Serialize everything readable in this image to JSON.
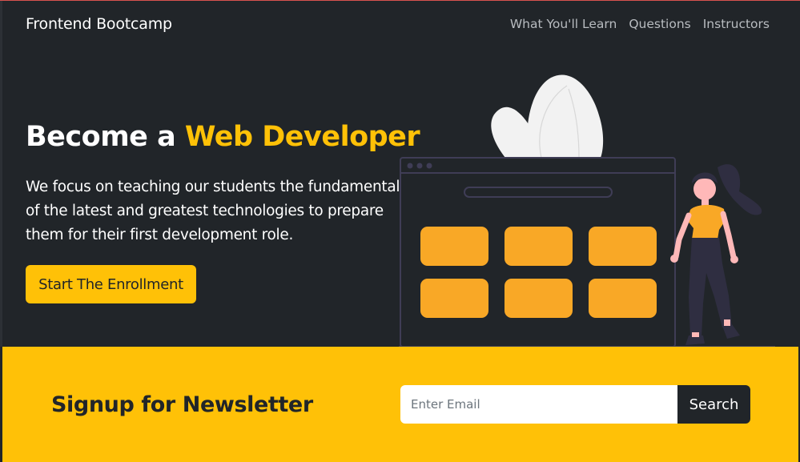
{
  "navbar": {
    "brand": "Frontend Bootcamp",
    "links": [
      "What You'll Learn",
      "Questions",
      "Instructors"
    ]
  },
  "hero": {
    "title_prefix": "Become a ",
    "title_accent": "Web Developer",
    "description": "We focus on teaching our students the fundamentals of the latest and greatest technologies to prepare them for their first development role.",
    "button_label": "Start The Enrollment"
  },
  "newsletter": {
    "title": "Signup for Newsletter",
    "email_placeholder": "Enter Email",
    "button_label": "Search"
  },
  "colors": {
    "background": "#212529",
    "accent": "#ffc107",
    "illustration_accent": "#f9a826",
    "text_light": "#ffffff",
    "nav_link": "#b8bcc0"
  },
  "icons": {
    "illustration": "web-developer-illustration"
  }
}
